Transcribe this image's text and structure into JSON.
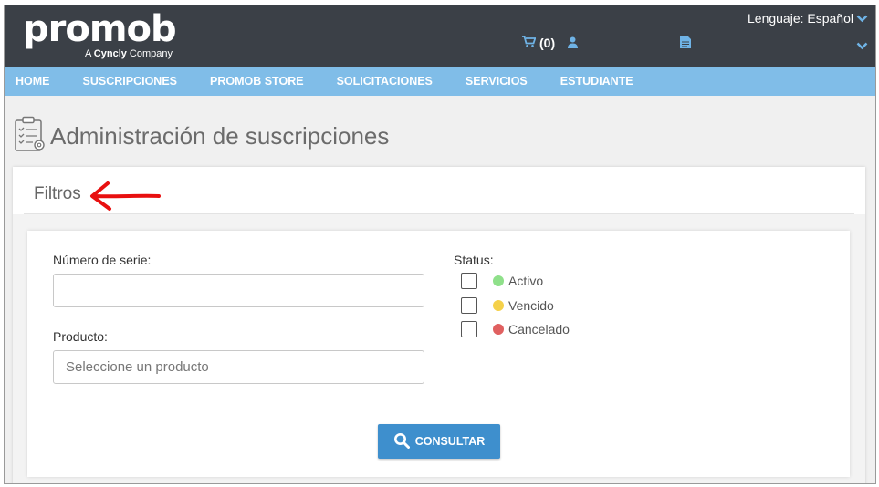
{
  "header": {
    "logo_text": "promob",
    "logo_sub_prefix": "A ",
    "logo_sub_brand": "Cyncly",
    "logo_sub_suffix": " Company",
    "cart_label": "(0)",
    "language_label": "Lenguaje: Español"
  },
  "nav": {
    "items": [
      "HOME",
      "SUSCRIPCIONES",
      "PROMOB STORE",
      "SOLICITACIONES",
      "SERVICIOS",
      "ESTUDIANTE"
    ]
  },
  "page": {
    "title": "Administración de suscripciones"
  },
  "filters": {
    "title": "Filtros",
    "serial_label": "Número de serie:",
    "serial_value": "",
    "product_label": "Producto:",
    "product_placeholder": "Seleccione un producto",
    "status_label": "Status:",
    "statuses": [
      {
        "label": "Activo",
        "color": "#8fe08a",
        "checked": false
      },
      {
        "label": "Vencido",
        "color": "#f5d14a",
        "checked": false
      },
      {
        "label": "Cancelado",
        "color": "#e06060",
        "checked": false
      }
    ],
    "submit_label": "CONSULTAR"
  },
  "colors": {
    "header_bg": "#3b4047",
    "nav_bg": "#80bde8",
    "button_bg": "#3e8fcd",
    "annotation_arrow": "#e81010"
  }
}
